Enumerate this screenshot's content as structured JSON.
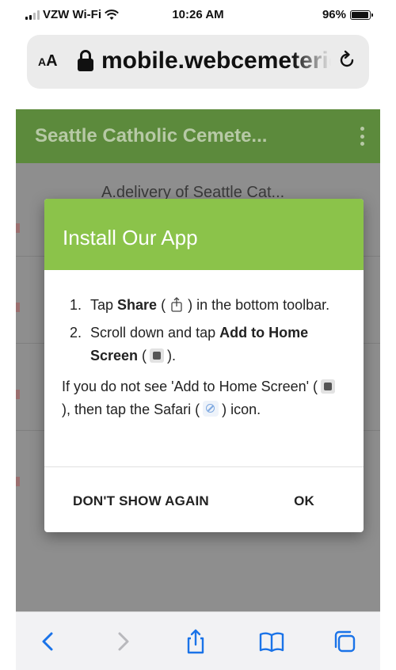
{
  "status_bar": {
    "carrier": "VZW Wi-Fi",
    "time": "10:26 AM",
    "battery_percent": "96%",
    "battery_level": 0.96
  },
  "browser": {
    "text_size_button": "AA",
    "url": "mobile.webcemeteries",
    "reload_icon": "reload-icon",
    "lock_icon": "lock-icon"
  },
  "app_header": {
    "title": "Seattle Catholic Cemete...",
    "menu_icon": "kebab-menu-icon",
    "color": "#5c8a3c"
  },
  "background_list": {
    "first_row_text": "A.delivery of Seattle Cat..."
  },
  "modal": {
    "title": "Install Our App",
    "header_color": "#8bc34a",
    "step1_num": "1.",
    "step1_prefix": "Tap ",
    "step1_bold": "Share",
    "step1_open": "(",
    "step1_close": ")",
    "step1_suffix": " in the bottom toolbar.",
    "step2_num": "2.",
    "step2_prefix": "Scroll down and tap ",
    "step2_bold": "Add to Home Screen",
    "step2_open": " (",
    "step2_close": ").",
    "note_part1": "If you do not see 'Add to Home Screen' (",
    "note_part2": "), then tap the Safari (",
    "note_part3": ") icon.",
    "dont_show_button": "DON'T SHOW AGAIN",
    "ok_button": "OK"
  },
  "toolbar": {
    "items": [
      "back-icon",
      "forward-icon",
      "share-icon",
      "bookmarks-icon",
      "tabs-icon"
    ],
    "accent_color": "#1a73e8"
  }
}
